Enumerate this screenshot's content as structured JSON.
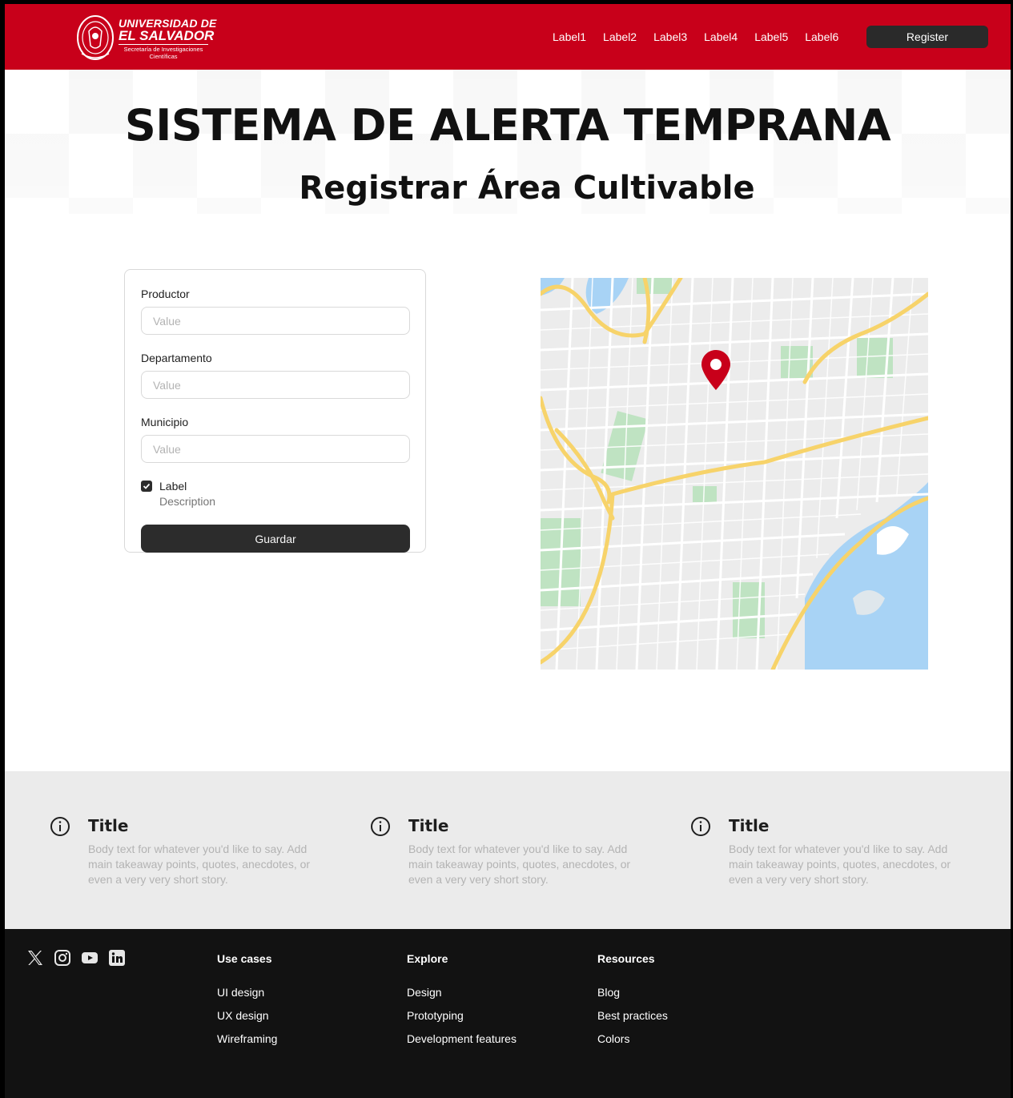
{
  "header": {
    "logo": {
      "line1": "UNIVERSIDAD DE",
      "line2": "EL SALVADOR",
      "sub1": "Secretaría de Investigaciones",
      "sub2": "Científicas"
    },
    "nav": [
      "Label1",
      "Label2",
      "Label3",
      "Label4",
      "Label5",
      "Label6"
    ],
    "register_label": "Register"
  },
  "hero": {
    "title": "SISTEMA DE ALERTA TEMPRANA",
    "subtitle": "Registrar Área Cultivable"
  },
  "form": {
    "fields": [
      {
        "label": "Productor",
        "placeholder": "Value"
      },
      {
        "label": "Departamento",
        "placeholder": "Value"
      },
      {
        "label": "Municipio",
        "placeholder": "Value"
      }
    ],
    "checkbox": {
      "label": "Label",
      "description": "Description",
      "checked": true
    },
    "save_label": "Guardar"
  },
  "map": {
    "pin_icon": "location-pin-icon",
    "pin_color": "#c8001a"
  },
  "features": [
    {
      "icon": "info-icon",
      "title": "Title",
      "body": "Body text for whatever you'd like to say. Add main takeaway points, quotes, anecdotes, or even a very very short story."
    },
    {
      "icon": "info-icon",
      "title": "Title",
      "body": "Body text for whatever you'd like to say. Add main takeaway points, quotes, anecdotes, or even a very very short story."
    },
    {
      "icon": "info-icon",
      "title": "Title",
      "body": "Body text for whatever you'd like to say. Add main takeaway points, quotes, anecdotes, or even a very very short story."
    }
  ],
  "footer": {
    "social_icons": [
      "x-icon",
      "instagram-icon",
      "youtube-icon",
      "linkedin-icon"
    ],
    "columns": [
      {
        "heading": "Use cases",
        "links": [
          "UI design",
          "UX design",
          "Wireframing"
        ]
      },
      {
        "heading": "Explore",
        "links": [
          "Design",
          "Prototyping",
          "Development features"
        ]
      },
      {
        "heading": "Resources",
        "links": [
          "Blog",
          "Best practices",
          "Colors"
        ]
      }
    ]
  },
  "colors": {
    "brand_red": "#c8001a",
    "dark": "#2c2c2c",
    "footer_bg": "#121212"
  }
}
